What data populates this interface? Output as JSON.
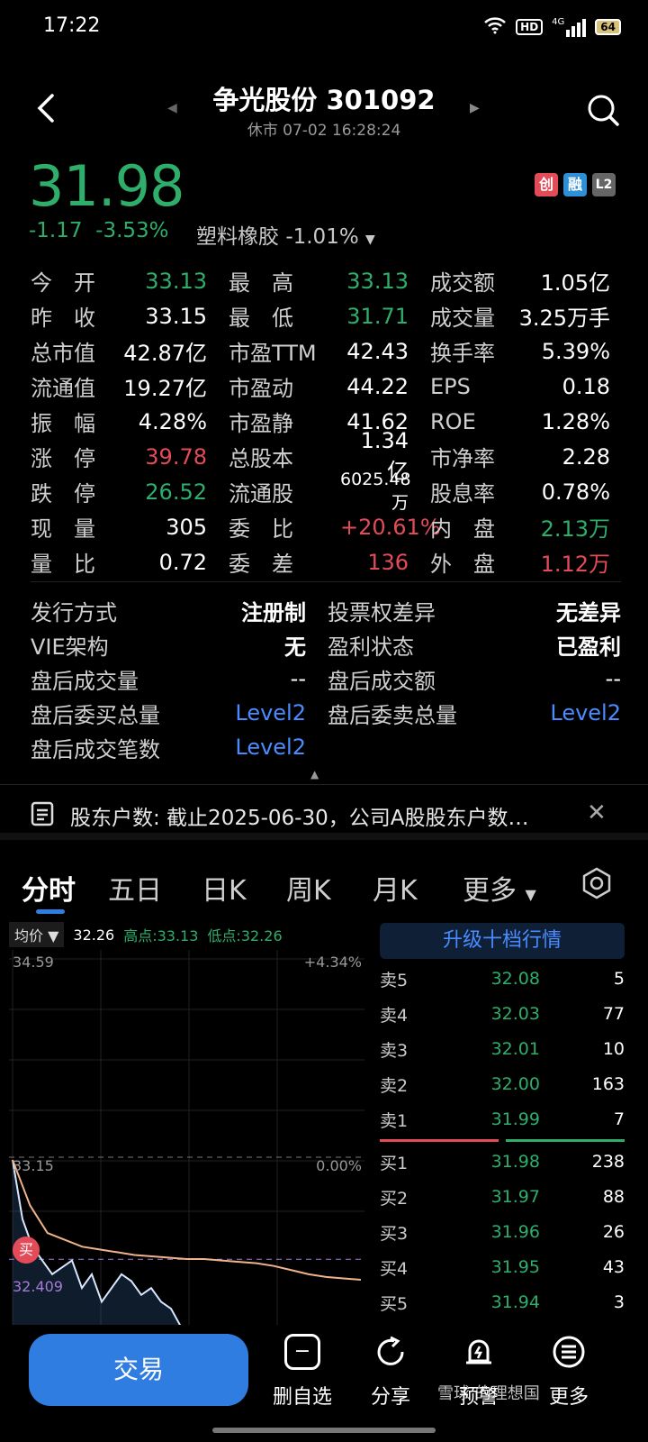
{
  "status_bar": {
    "time": "17:22",
    "hd": "HD",
    "network": "4G",
    "battery": "64"
  },
  "header": {
    "title": "争光股份 301092",
    "subtitle": "休市  07-02 16:28:24",
    "back_icon": "chevron-left-icon",
    "search_icon": "search-icon"
  },
  "quote": {
    "price": "31.98",
    "change": "-1.17",
    "change_pct": "-3.53%",
    "sector": "塑料橡胶",
    "sector_change": "-1.01%",
    "badges": [
      "创",
      "融",
      "L2"
    ]
  },
  "stats": [
    [
      {
        "label": "今　开",
        "value": "33.13",
        "color": "green"
      },
      {
        "label": "最　高",
        "value": "33.13",
        "color": "green"
      },
      {
        "label": "成交额",
        "value": "1.05亿",
        "color": "white"
      }
    ],
    [
      {
        "label": "昨　收",
        "value": "33.15",
        "color": "white"
      },
      {
        "label": "最　低",
        "value": "31.71",
        "color": "green"
      },
      {
        "label": "成交量",
        "value": "3.25万手",
        "color": "white"
      }
    ],
    [
      {
        "label": "总市值",
        "value": "42.87亿",
        "color": "white"
      },
      {
        "label": "市盈TTM",
        "value": "42.43",
        "color": "white"
      },
      {
        "label": "换手率",
        "value": "5.39%",
        "color": "white"
      }
    ],
    [
      {
        "label": "流通值",
        "value": "19.27亿",
        "color": "white"
      },
      {
        "label": "市盈动",
        "value": "44.22",
        "color": "white"
      },
      {
        "label": "EPS",
        "value": "0.18",
        "color": "white"
      }
    ],
    [
      {
        "label": "振　幅",
        "value": "4.28%",
        "color": "white"
      },
      {
        "label": "市盈静",
        "value": "41.62",
        "color": "white"
      },
      {
        "label": "ROE",
        "value": "1.28%",
        "color": "white"
      }
    ],
    [
      {
        "label": "涨　停",
        "value": "39.78",
        "color": "red"
      },
      {
        "label": "总股本",
        "value": "1.34亿",
        "color": "white"
      },
      {
        "label": "市净率",
        "value": "2.28",
        "color": "white"
      }
    ],
    [
      {
        "label": "跌　停",
        "value": "26.52",
        "color": "green"
      },
      {
        "label": "流通股",
        "value": "6025.48万",
        "color": "white"
      },
      {
        "label": "股息率",
        "value": "0.78%",
        "color": "white"
      }
    ],
    [
      {
        "label": "现　量",
        "value": "305",
        "color": "white"
      },
      {
        "label": "委　比",
        "value": "+20.61%",
        "color": "red"
      },
      {
        "label": "内　盘",
        "value": "2.13万",
        "color": "green"
      }
    ],
    [
      {
        "label": "量　比",
        "value": "0.72",
        "color": "white"
      },
      {
        "label": "委　差",
        "value": "136",
        "color": "red"
      },
      {
        "label": "外　盘",
        "value": "1.12万",
        "color": "red"
      }
    ]
  ],
  "info": [
    [
      {
        "label": "发行方式",
        "value": "注册制"
      },
      {
        "label": "投票权差异",
        "value": "无差异"
      }
    ],
    [
      {
        "label": "VIE架构",
        "value": "无"
      },
      {
        "label": "盈利状态",
        "value": "已盈利"
      }
    ],
    [
      {
        "label": "盘后成交量",
        "value": "--"
      },
      {
        "label": "盘后成交额",
        "value": "--"
      }
    ],
    [
      {
        "label": "盘后委买总量",
        "value": "Level2"
      },
      {
        "label": "盘后委卖总量",
        "value": "Level2"
      }
    ],
    [
      {
        "label": "盘后成交笔数",
        "value": "Level2"
      }
    ]
  ],
  "notice": {
    "text": "股东户数: 截止2025-06-30，公司A股股东户数…",
    "icon": "document-icon",
    "close_icon": "close-icon"
  },
  "tabs": [
    "分时",
    "五日",
    "日K",
    "周K",
    "月K",
    "更多"
  ],
  "chart_header": {
    "avg_label": "均价",
    "avg_value": "32.26",
    "high": "高点:33.13",
    "low": "低点:32.26"
  },
  "chart_axes": {
    "top_price": "34.59",
    "top_pct": "+4.34%",
    "mid_price": "33.15",
    "mid_pct": "0.00%",
    "marker": "32.409",
    "buy_tag": "买"
  },
  "chart_data": {
    "type": "line",
    "series": [
      {
        "values": [
          33.13,
          32.7,
          32.5,
          32.4,
          32.3,
          32.35,
          32.4,
          32.2,
          32.3,
          32.1,
          32.2,
          32.3,
          32.25,
          32.15,
          32.2,
          32.1,
          32.05,
          31.9,
          31.5,
          31.2,
          31.0
        ]
      },
      {
        "values": [
          33.13,
          32.8,
          32.6,
          32.55,
          32.5,
          32.48,
          32.46,
          32.44,
          32.43,
          32.42,
          32.41,
          32.41,
          32.4,
          32.39,
          32.38,
          32.36,
          32.33,
          32.3,
          32.28,
          32.27,
          32.26
        ]
      }
    ]
  },
  "orderbook": {
    "upgrade_label": "升级十档行情",
    "sell": [
      {
        "label": "卖5",
        "price": "32.08",
        "qty": "5"
      },
      {
        "label": "卖4",
        "price": "32.03",
        "qty": "77"
      },
      {
        "label": "卖3",
        "price": "32.01",
        "qty": "10"
      },
      {
        "label": "卖2",
        "price": "32.00",
        "qty": "163"
      },
      {
        "label": "卖1",
        "price": "31.99",
        "qty": "7"
      }
    ],
    "buy": [
      {
        "label": "买1",
        "price": "31.98",
        "qty": "238"
      },
      {
        "label": "买2",
        "price": "31.97",
        "qty": "88"
      },
      {
        "label": "买3",
        "price": "31.96",
        "qty": "26"
      },
      {
        "label": "买4",
        "price": "31.95",
        "qty": "43"
      },
      {
        "label": "买5",
        "price": "31.94",
        "qty": "3"
      }
    ]
  },
  "bottom": {
    "trade": "交易",
    "delete": "删自选",
    "share": "分享",
    "alert": "预警",
    "more": "更多",
    "watermark": "雪球 的理想国"
  }
}
